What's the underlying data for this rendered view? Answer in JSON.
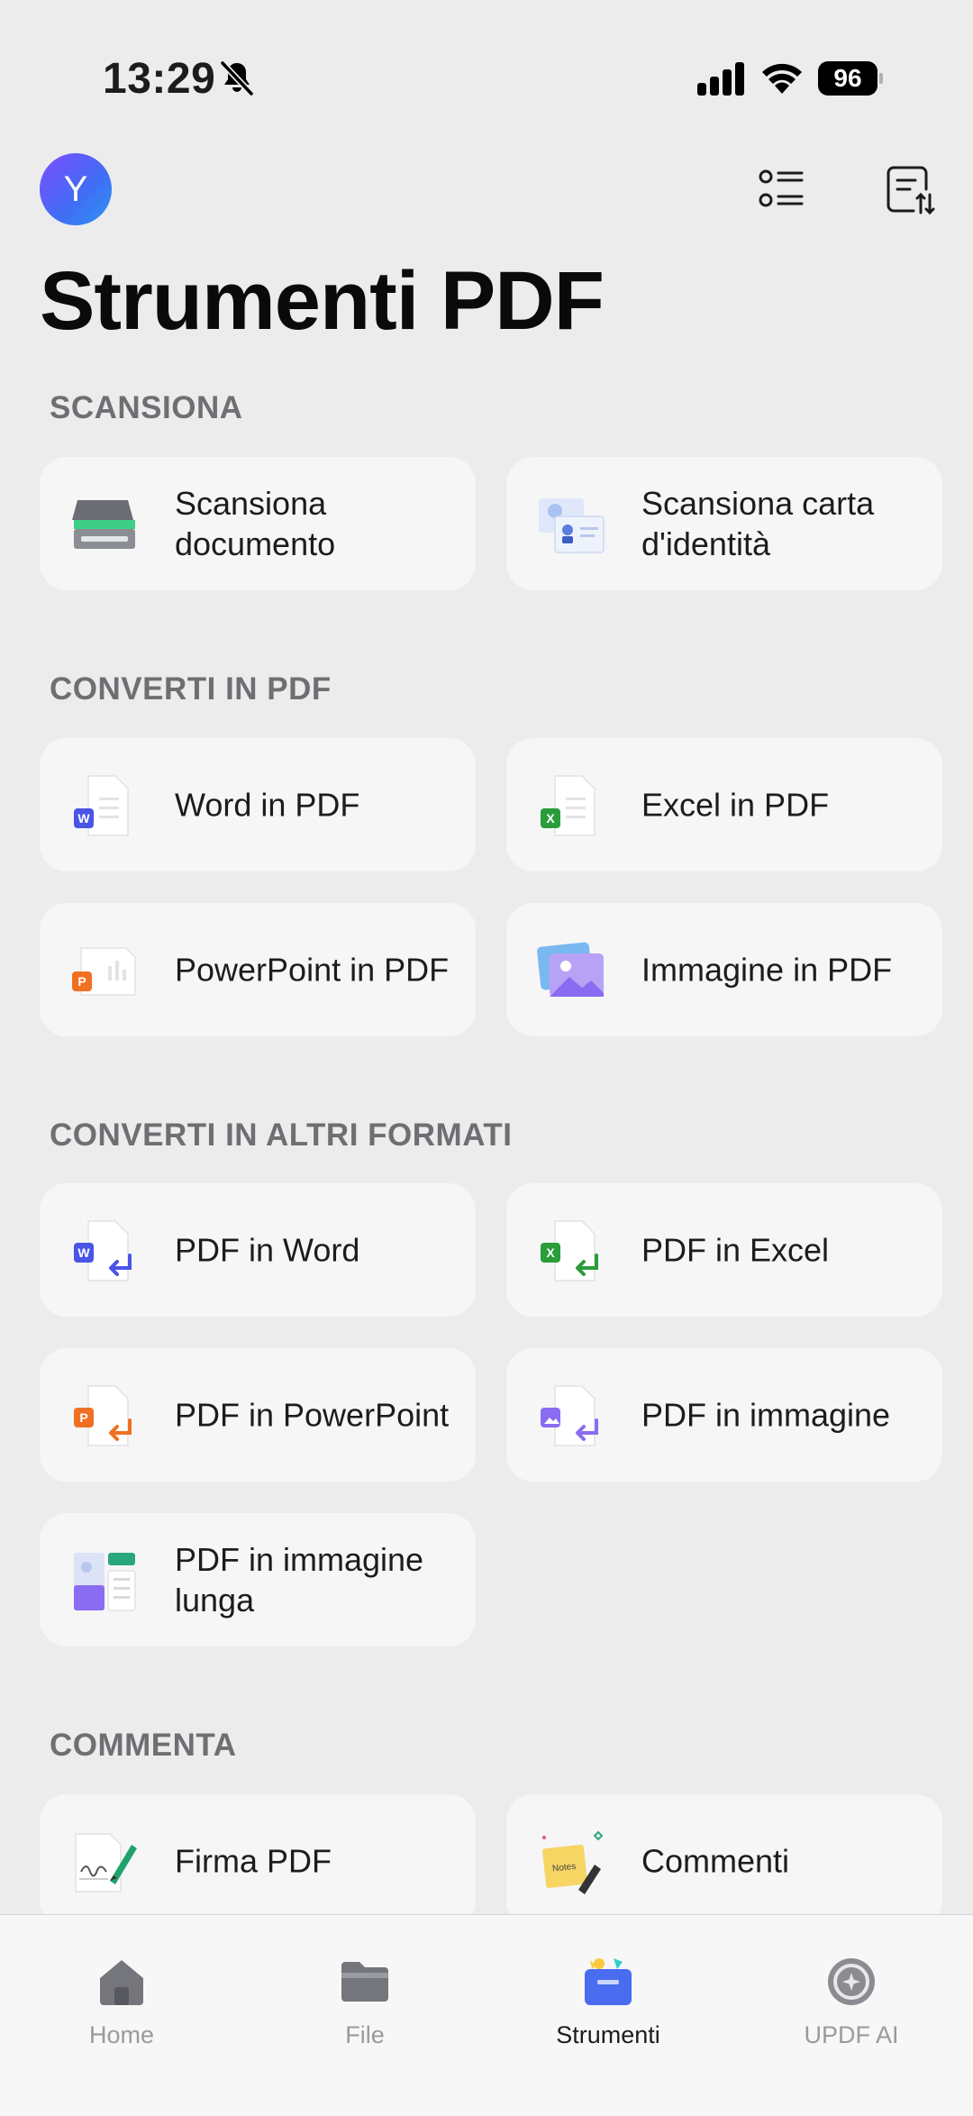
{
  "status_bar": {
    "time": "13:29",
    "battery": "96"
  },
  "header": {
    "avatar_initial": "Y",
    "title": "Strumenti PDF"
  },
  "sections": {
    "scan": {
      "title": "SCANSIONA",
      "items": [
        "Scansiona documento",
        "Scansiona carta d'identità"
      ]
    },
    "to_pdf": {
      "title": "CONVERTI IN PDF",
      "items": [
        "Word in PDF",
        "Excel in PDF",
        "PowerPoint in PDF",
        "Immagine in PDF"
      ]
    },
    "from_pdf": {
      "title": "CONVERTI IN ALTRI FORMATI",
      "items": [
        "PDF in Word",
        "PDF in Excel",
        "PDF in PowerPoint",
        "PDF in immagine",
        "PDF in immagine lunga"
      ]
    },
    "annotate": {
      "title": "COMMENTA",
      "items": [
        "Firma PDF",
        "Commenti"
      ]
    }
  },
  "tabs": [
    {
      "label": "Home",
      "icon": "home-icon"
    },
    {
      "label": "File",
      "icon": "folder-icon"
    },
    {
      "label": "Strumenti",
      "icon": "tools-icon",
      "active": true
    },
    {
      "label": "UPDF AI",
      "icon": "ai-icon"
    }
  ],
  "colors": {
    "word": "#4a55e6",
    "excel": "#2a9d3a",
    "powerpoint": "#f07023",
    "image": "#8a6cf2",
    "accent": "#3f6ef5"
  }
}
